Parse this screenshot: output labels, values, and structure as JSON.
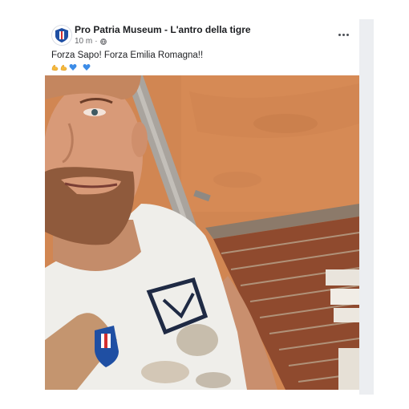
{
  "post": {
    "page_name": "Pro Patria Museum - L'antro della tigre",
    "time": "10 m",
    "separator": "·",
    "text": "Forza Sapo! Forza Emilia Romagna!!",
    "emojis": [
      "flexed-biceps",
      "flexed-biceps",
      "blue-heart",
      "blue-heart"
    ],
    "photo_icon": "selfie-photo"
  },
  "colors": {
    "text": "#1c1e21",
    "meta": "#65676b",
    "heart": "#3c8ce7",
    "wall": "#d48550",
    "brick": "#9a4a2d"
  }
}
